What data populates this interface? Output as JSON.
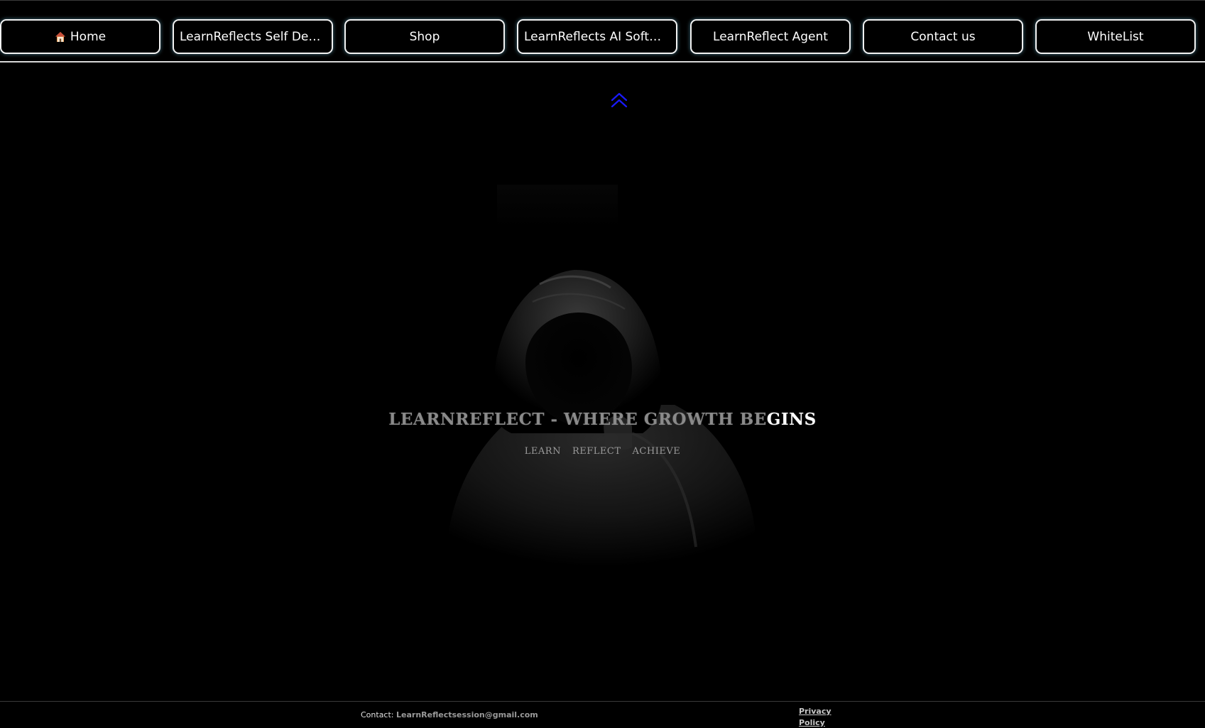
{
  "nav": {
    "items": [
      {
        "label": "Home",
        "icon": "home-icon"
      },
      {
        "label": "LearnReflects Self Develo..."
      },
      {
        "label": "Shop"
      },
      {
        "label": "LearnReflects AI Software"
      },
      {
        "label": "LearnReflect Agent"
      },
      {
        "label": "Contact us"
      },
      {
        "label": "WhiteList"
      }
    ]
  },
  "scroll_up": {
    "icon": "double-chevron-up-icon",
    "color": "#1a1aff"
  },
  "hero": {
    "image": "hooded-figure-image",
    "title_dim": "LEARNREFLECT - WHERE GROWTH BE",
    "title_bright": "GINS",
    "tagline": [
      "LEARN",
      "REFLECT",
      "ACHIEVE"
    ]
  },
  "footer": {
    "contact_label": "Contact:",
    "contact_email": "LearnReflectsession@gmail.com",
    "privacy_label": "Privacy Policy"
  },
  "colors": {
    "background": "#000000",
    "nav_border": "#f2f2f2",
    "glow": "#78c8e6"
  }
}
